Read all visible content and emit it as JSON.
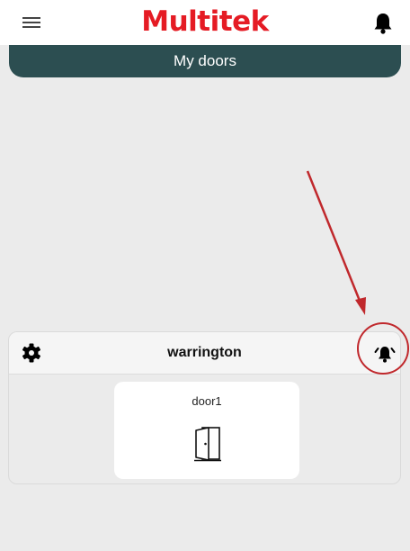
{
  "app": {
    "brand": "Multitek"
  },
  "header": {
    "title": "My doors"
  },
  "location": {
    "name": "warrington",
    "doors": [
      {
        "name": "door1"
      }
    ]
  },
  "colors": {
    "brand_red": "#e51b24",
    "header_teal": "#2c4e51",
    "annotation_red": "#c0282c"
  },
  "icons": {
    "menu": "hamburger-menu-icon",
    "notifications": "bell-icon",
    "settings": "gear-icon",
    "alarm": "ringing-bell-icon",
    "door": "open-door-icon"
  }
}
